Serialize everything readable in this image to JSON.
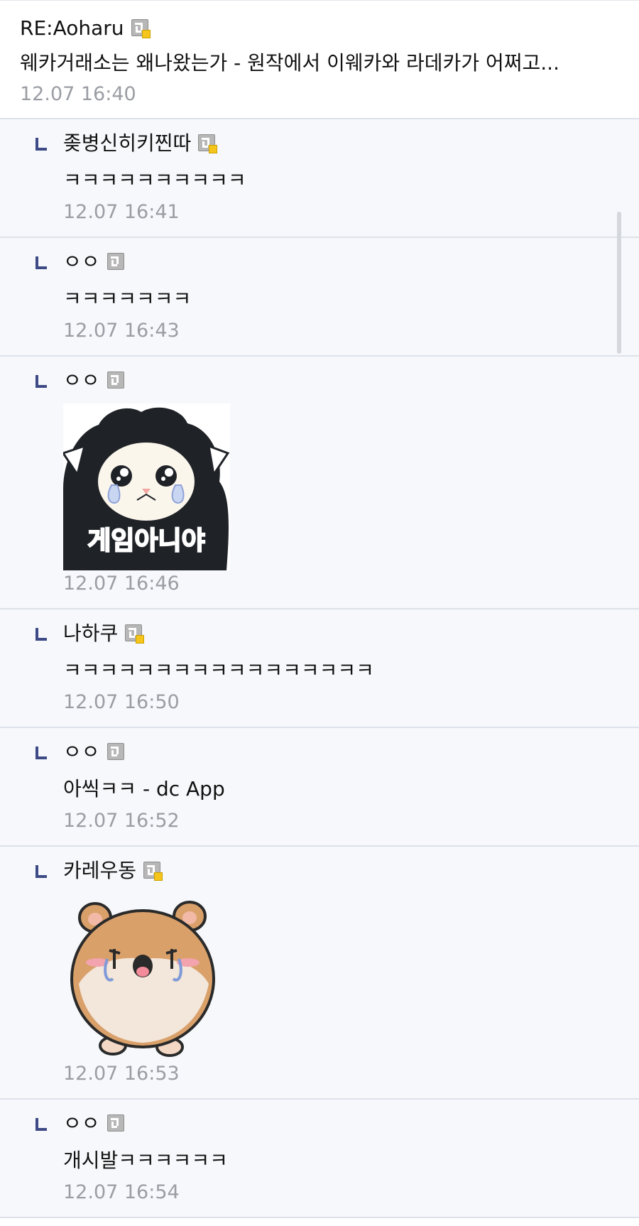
{
  "post": {
    "nickname": "RE:Aoharu",
    "body": "웨카거래소는 왜나왔는가 - 원작에서 이웨카와 라데카가 어쩌고...",
    "time": "12.07 16:40"
  },
  "replies": [
    {
      "nickname": "좆병신히키찐따",
      "fixed": true,
      "body": "ㅋㅋㅋㅋㅋㅋㅋㅋㅋㅋ",
      "time": "12.07 16:41"
    },
    {
      "nickname": "ㅇㅇ",
      "fixed": false,
      "body": "ㅋㅋㅋㅋㅋㅋㅋ",
      "time": "12.07 16:43"
    },
    {
      "nickname": "ㅇㅇ",
      "fixed": false,
      "sticker": "crying-sheep-sticker",
      "sticker_text": "게임아니야",
      "time": "12.07 16:46"
    },
    {
      "nickname": "나하쿠",
      "fixed": true,
      "body": "ㅋㅋㅋㅋㅋㅋㅋㅋㅋㅋㅋㅋㅋㅋㅋㅋㅋ",
      "time": "12.07 16:50"
    },
    {
      "nickname": "ㅇㅇ",
      "fixed": false,
      "body": "아씩ㅋㅋ - dc App",
      "time": "12.07 16:52"
    },
    {
      "nickname": "카레우동",
      "fixed": true,
      "sticker": "crying-hamster-sticker",
      "time": "12.07 16:53"
    },
    {
      "nickname": "ㅇㅇ",
      "fixed": false,
      "body": "개시발ㅋㅋㅋㅋㅋㅋ",
      "time": "12.07 16:54"
    }
  ],
  "icons": {
    "reply": "reply-arrow-icon",
    "gallog": "gallog-icon",
    "fixed_badge": "fixed-nick-badge-icon"
  },
  "colors": {
    "reply_marker": "#3d4a86",
    "reply_background": "#f6f8fb",
    "timestamp": "#9a9da3",
    "fixed_badge": "#f5c51b"
  }
}
